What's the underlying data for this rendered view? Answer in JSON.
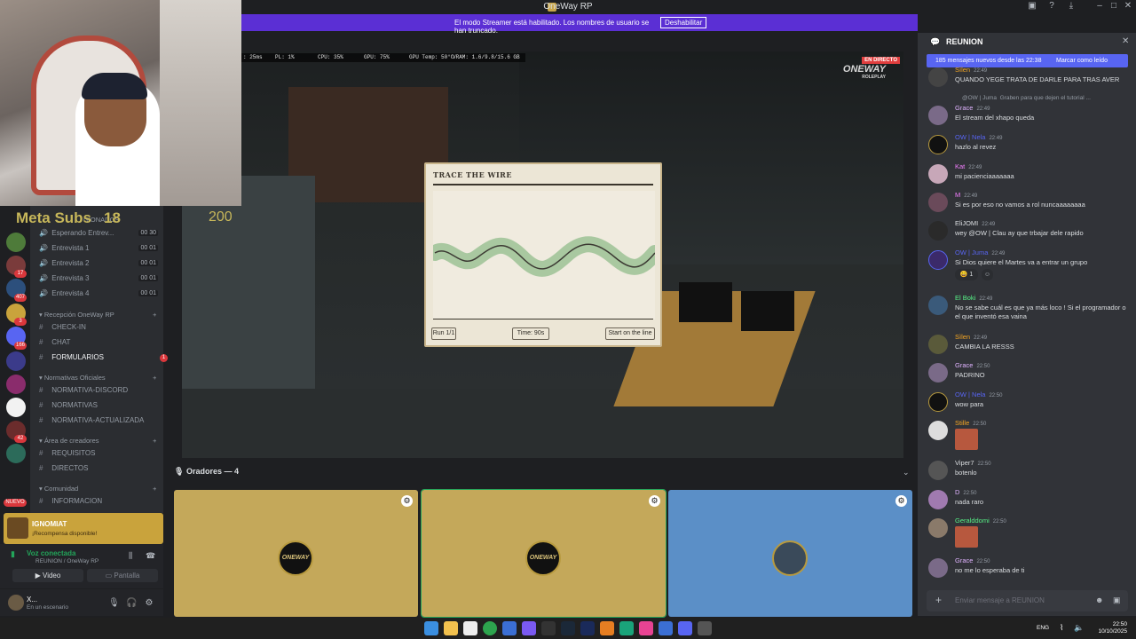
{
  "titlebar": {
    "title": "OneWay RP"
  },
  "banner": {
    "message": "El modo Streamer está habilitado. Los nombres de usuario se han truncado.",
    "button": "Deshabilitar"
  },
  "overlay": {
    "metasubs_label": "Meta Subs",
    "metasubs_value": "18",
    "score": "200"
  },
  "perf": {
    "ping": ": 25ms",
    "pl": "PL: 1%",
    "cpu": "CPU: 35%",
    "gpu": "GPU: 75%",
    "gputemp": "GPU Temp: 50°C",
    "vram": "VRAM: 1.6/9.8/15.6 GB"
  },
  "stream": {
    "live": "EN DIRECTO",
    "logo": "ONEWAY",
    "logo_sub": "ROLEPLAY"
  },
  "guild_badges": [
    "17",
    "407",
    "3",
    "166",
    "42",
    "NUEVO"
  ],
  "channels": {
    "header_fragment": "GIONADOS",
    "voice": [
      {
        "label": "Esperando Entrev...",
        "a": "00",
        "b": "30"
      },
      {
        "label": "Entrevista 1",
        "a": "00",
        "b": "01"
      },
      {
        "label": "Entrevista 2",
        "a": "00",
        "b": "01"
      },
      {
        "label": "Entrevista 3",
        "a": "00",
        "b": "01"
      },
      {
        "label": "Entrevista 4",
        "a": "00",
        "b": "01"
      }
    ],
    "cat_recepcion": "Recepción OneWay RP",
    "recepcion": [
      "CHECK-IN",
      "CHAT",
      "FORMULARIOS"
    ],
    "formularios_badge": "1",
    "cat_normativas": "Normativas Oficiales",
    "normativas": [
      "NORMATIVA-DISCORD",
      "NORMATIVAS",
      "NORMATIVA-ACTUALIZADA"
    ],
    "cat_creadores": "Área de creadores",
    "creadores": [
      "REQUISITOS",
      "DIRECTOS"
    ],
    "cat_comunidad": "Comunidad",
    "comunidad": [
      "INFORMACION"
    ]
  },
  "nowplaying": {
    "title": "IGNOMIAT",
    "subtitle": "¡Recompensa disponible!"
  },
  "voice_panel": {
    "status": "Voz conectada",
    "location": "REUNION  / OneWay RP",
    "video": "Video",
    "screen": "Pantalla"
  },
  "user": {
    "name": "X...",
    "status": "En un escenario"
  },
  "minigame": {
    "title": "TRACE THE WIRE",
    "run": "Run 1/1",
    "time": "Time: 90s",
    "start": "Start on the line"
  },
  "speakers": {
    "header": "Oradores — 4",
    "tiles": [
      {
        "logo": "ONEWAY",
        "color": "#c4a85a"
      },
      {
        "logo": "ONEWAY",
        "color": "#c4a85a"
      },
      {
        "logo": "",
        "color": "#5b8fc7"
      }
    ]
  },
  "chat": {
    "title": "REUNION",
    "new_messages": "185 mensajes nuevos desde las 22:38",
    "mark_read": "Marcar como leído",
    "reply_fragment": "@OW | Juma",
    "reply_text": "Graben para que dejen el tutorial ...",
    "messages": [
      {
        "name": "Sìlen",
        "color": "#f5a623",
        "time": "22:49",
        "text": "QUANDO YEGE TRATA DE DARLE PARA TRAS AVER"
      },
      {
        "name": "Grace",
        "color": "#e0b3ff",
        "time": "22:49",
        "text": "El stream del xhapo queda"
      },
      {
        "name": "OW | Nela",
        "color": "#5865f2",
        "time": "22:49",
        "text": "hazlo al revez"
      },
      {
        "name": "Kat",
        "color": "#f47fff",
        "time": "22:49",
        "text": "mi pacienciaaaaaaa"
      },
      {
        "name": "M",
        "color": "#f47fff",
        "time": "22:49",
        "text": "Si es por eso no vamos a rol nuncaaaaaaaa"
      },
      {
        "name": "EliJOMI",
        "color": "#dbdee1",
        "time": "22:49",
        "text": "wey @OW | Clau ay que trbajar dele rapido"
      },
      {
        "name": "OW | Juma",
        "color": "#5865f2",
        "time": "22:49",
        "text": "Si Dios quiere el Martes va a entrar un grupo"
      },
      {
        "name": "El Boki",
        "color": "#57f287",
        "time": "22:49",
        "text": "No se sabe cuál es que ya más loco ! Si el programador o el que inventó esa vaina"
      },
      {
        "name": "Sìlen",
        "color": "#f5a623",
        "time": "22:49",
        "text": "CAMBIA LA RESSS"
      },
      {
        "name": "Grace",
        "color": "#e0b3ff",
        "time": "22:50",
        "text": "PADRINO"
      },
      {
        "name": "OW | Nela",
        "color": "#5865f2",
        "time": "22:50",
        "text": "wow para"
      },
      {
        "name": "Stille",
        "color": "#f5a623",
        "time": "22:50",
        "text": ""
      },
      {
        "name": "Viper7",
        "color": "#dbdee1",
        "time": "22:50",
        "text": "botenlo"
      },
      {
        "name": "D",
        "color": "#e0b3ff",
        "time": "22:50",
        "text": "nada raro"
      },
      {
        "name": "Geralddomi",
        "color": "#57f287",
        "time": "22:50",
        "text": ""
      },
      {
        "name": "Grace",
        "color": "#e0b3ff",
        "time": "22:50",
        "text": "no me lo esperaba de ti"
      }
    ],
    "reaction_count": "1",
    "input_placeholder": "Enviar mensaje a  REUNION"
  },
  "taskbar": {
    "lang": "ENG",
    "time": "22:50",
    "date": "10/10/2025"
  }
}
